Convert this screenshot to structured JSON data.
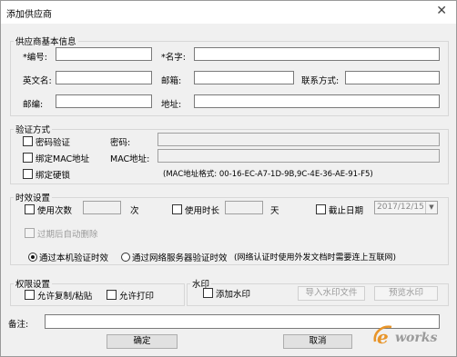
{
  "window": {
    "title": "添加供应商",
    "close_glyph": "✕"
  },
  "basic": {
    "legend": "供应商基本信息",
    "id_label": "*编号:",
    "name_label": "*名字:",
    "english_label": "英文名:",
    "email_label": "邮箱:",
    "contact_label": "联系方式:",
    "postcode_label": "邮编:",
    "address_label": "地址:",
    "id_value": "",
    "name_value": "",
    "english_value": "",
    "email_value": "",
    "contact_value": "",
    "postcode_value": "",
    "address_value": ""
  },
  "verify": {
    "legend": "验证方式",
    "password_check": "密码验证",
    "password_label": "密码:",
    "bind_mac": "绑定MAC地址",
    "mac_label": "MAC地址:",
    "bind_dongle": "绑定硬锁",
    "mac_hint": "(MAC地址格式: 00-16-EC-A7-1D-9B,9C-4E-36-AE-91-F5)"
  },
  "validity": {
    "legend": "时效设置",
    "use_count": "使用次数",
    "count_unit": "次",
    "use_duration": "使用时长",
    "duration_unit": "天",
    "deadline": "截止日期",
    "date_value": "2017/12/15",
    "auto_delete": "过期后自动删除",
    "radio_local": "通过本机验证时效",
    "radio_server": "通过网络服务器验证时效",
    "radio_note": "(网络认证时使用外发文档时需要连上互联网)"
  },
  "permission": {
    "legend": "权限设置",
    "allow_copy": "允许复制/粘贴",
    "allow_print": "允许打印"
  },
  "watermark": {
    "legend": "水印",
    "add": "添加水印",
    "import_btn": "导入水印文件",
    "preview_btn": "预览水印"
  },
  "remark": {
    "label": "备注:",
    "value": ""
  },
  "footer": {
    "ok": "确定",
    "cancel": "取消",
    "logo_text": "works",
    "logo_letter": "e"
  },
  "colors": {
    "logo_orange": "#e8952a",
    "logo_gray": "#9a9a9a"
  }
}
